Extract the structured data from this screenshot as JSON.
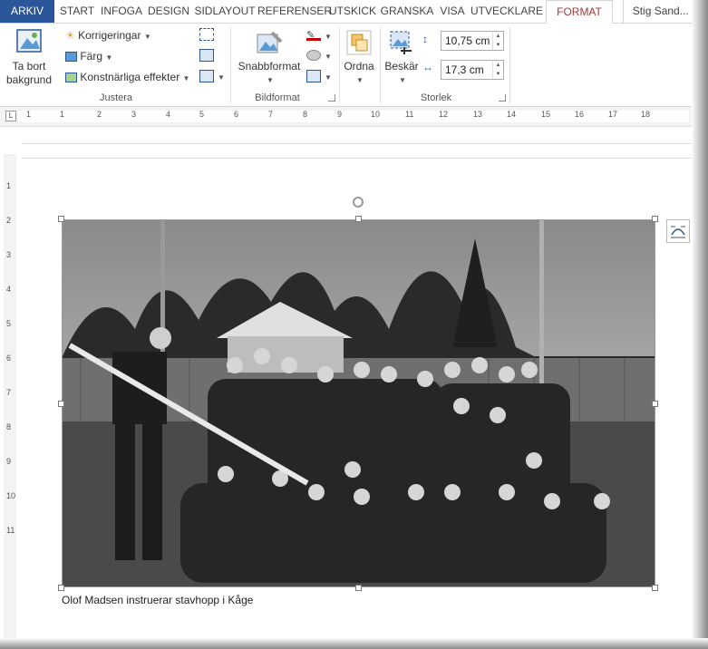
{
  "tabs": [
    "ARKIV",
    "START",
    "INFOGA",
    "DESIGN",
    "SIDLAYOUT",
    "REFERENSER",
    "UTSKICK",
    "GRANSKA",
    "VISA",
    "UTVECKLARE",
    "FORMAT"
  ],
  "active_tab": "FORMAT",
  "user": "Stig Sand...",
  "ribbon": {
    "remove_background": "Ta bort bakgrund",
    "corrections": "Korrigeringar",
    "color": "Färg",
    "artistic_effects": "Konstnärliga effekter",
    "group_adjust": "Justera",
    "quick_styles": "Snabbformat",
    "group_picture_styles": "Bildformat",
    "arrange": "Ordna",
    "crop": "Beskär",
    "height_value": "10,75 cm",
    "width_value": "17,3 cm",
    "group_size": "Storlek"
  },
  "ruler": {
    "numbers": [
      "1",
      "1",
      "2",
      "3",
      "4",
      "5",
      "6",
      "7",
      "8",
      "9",
      "10",
      "11",
      "12",
      "13",
      "14",
      "15",
      "16",
      "17",
      "18"
    ],
    "vertical_numbers": [
      "1",
      "2",
      "3",
      "4",
      "5",
      "6",
      "7",
      "8",
      "9",
      "10",
      "11"
    ]
  },
  "caption": "Olof Madsen instruerar stavhopp i Kåge",
  "colors": {
    "file_tab": "#2b579a",
    "format_tab": "#a4373a"
  }
}
